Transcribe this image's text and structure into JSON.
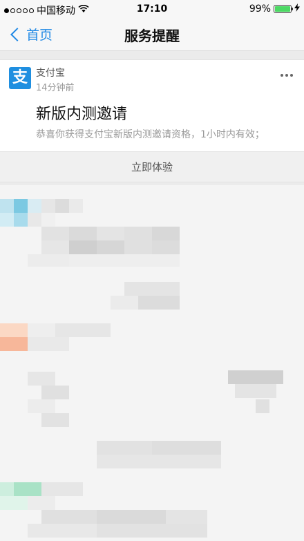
{
  "status_bar": {
    "carrier": "中国移动",
    "time": "17:10",
    "battery_percent": "99%",
    "battery_level": 0.99
  },
  "nav": {
    "back_label": "首页",
    "title": "服务提醒"
  },
  "card": {
    "sender": "支付宝",
    "time_ago": "14分钟前",
    "logo_glyph": "支",
    "title": "新版内测邀请",
    "description": "恭喜你获得支付宝新版内测邀请资格，1小时内有效；",
    "action_label": "立即体验",
    "accent": "#1f8fe0"
  }
}
